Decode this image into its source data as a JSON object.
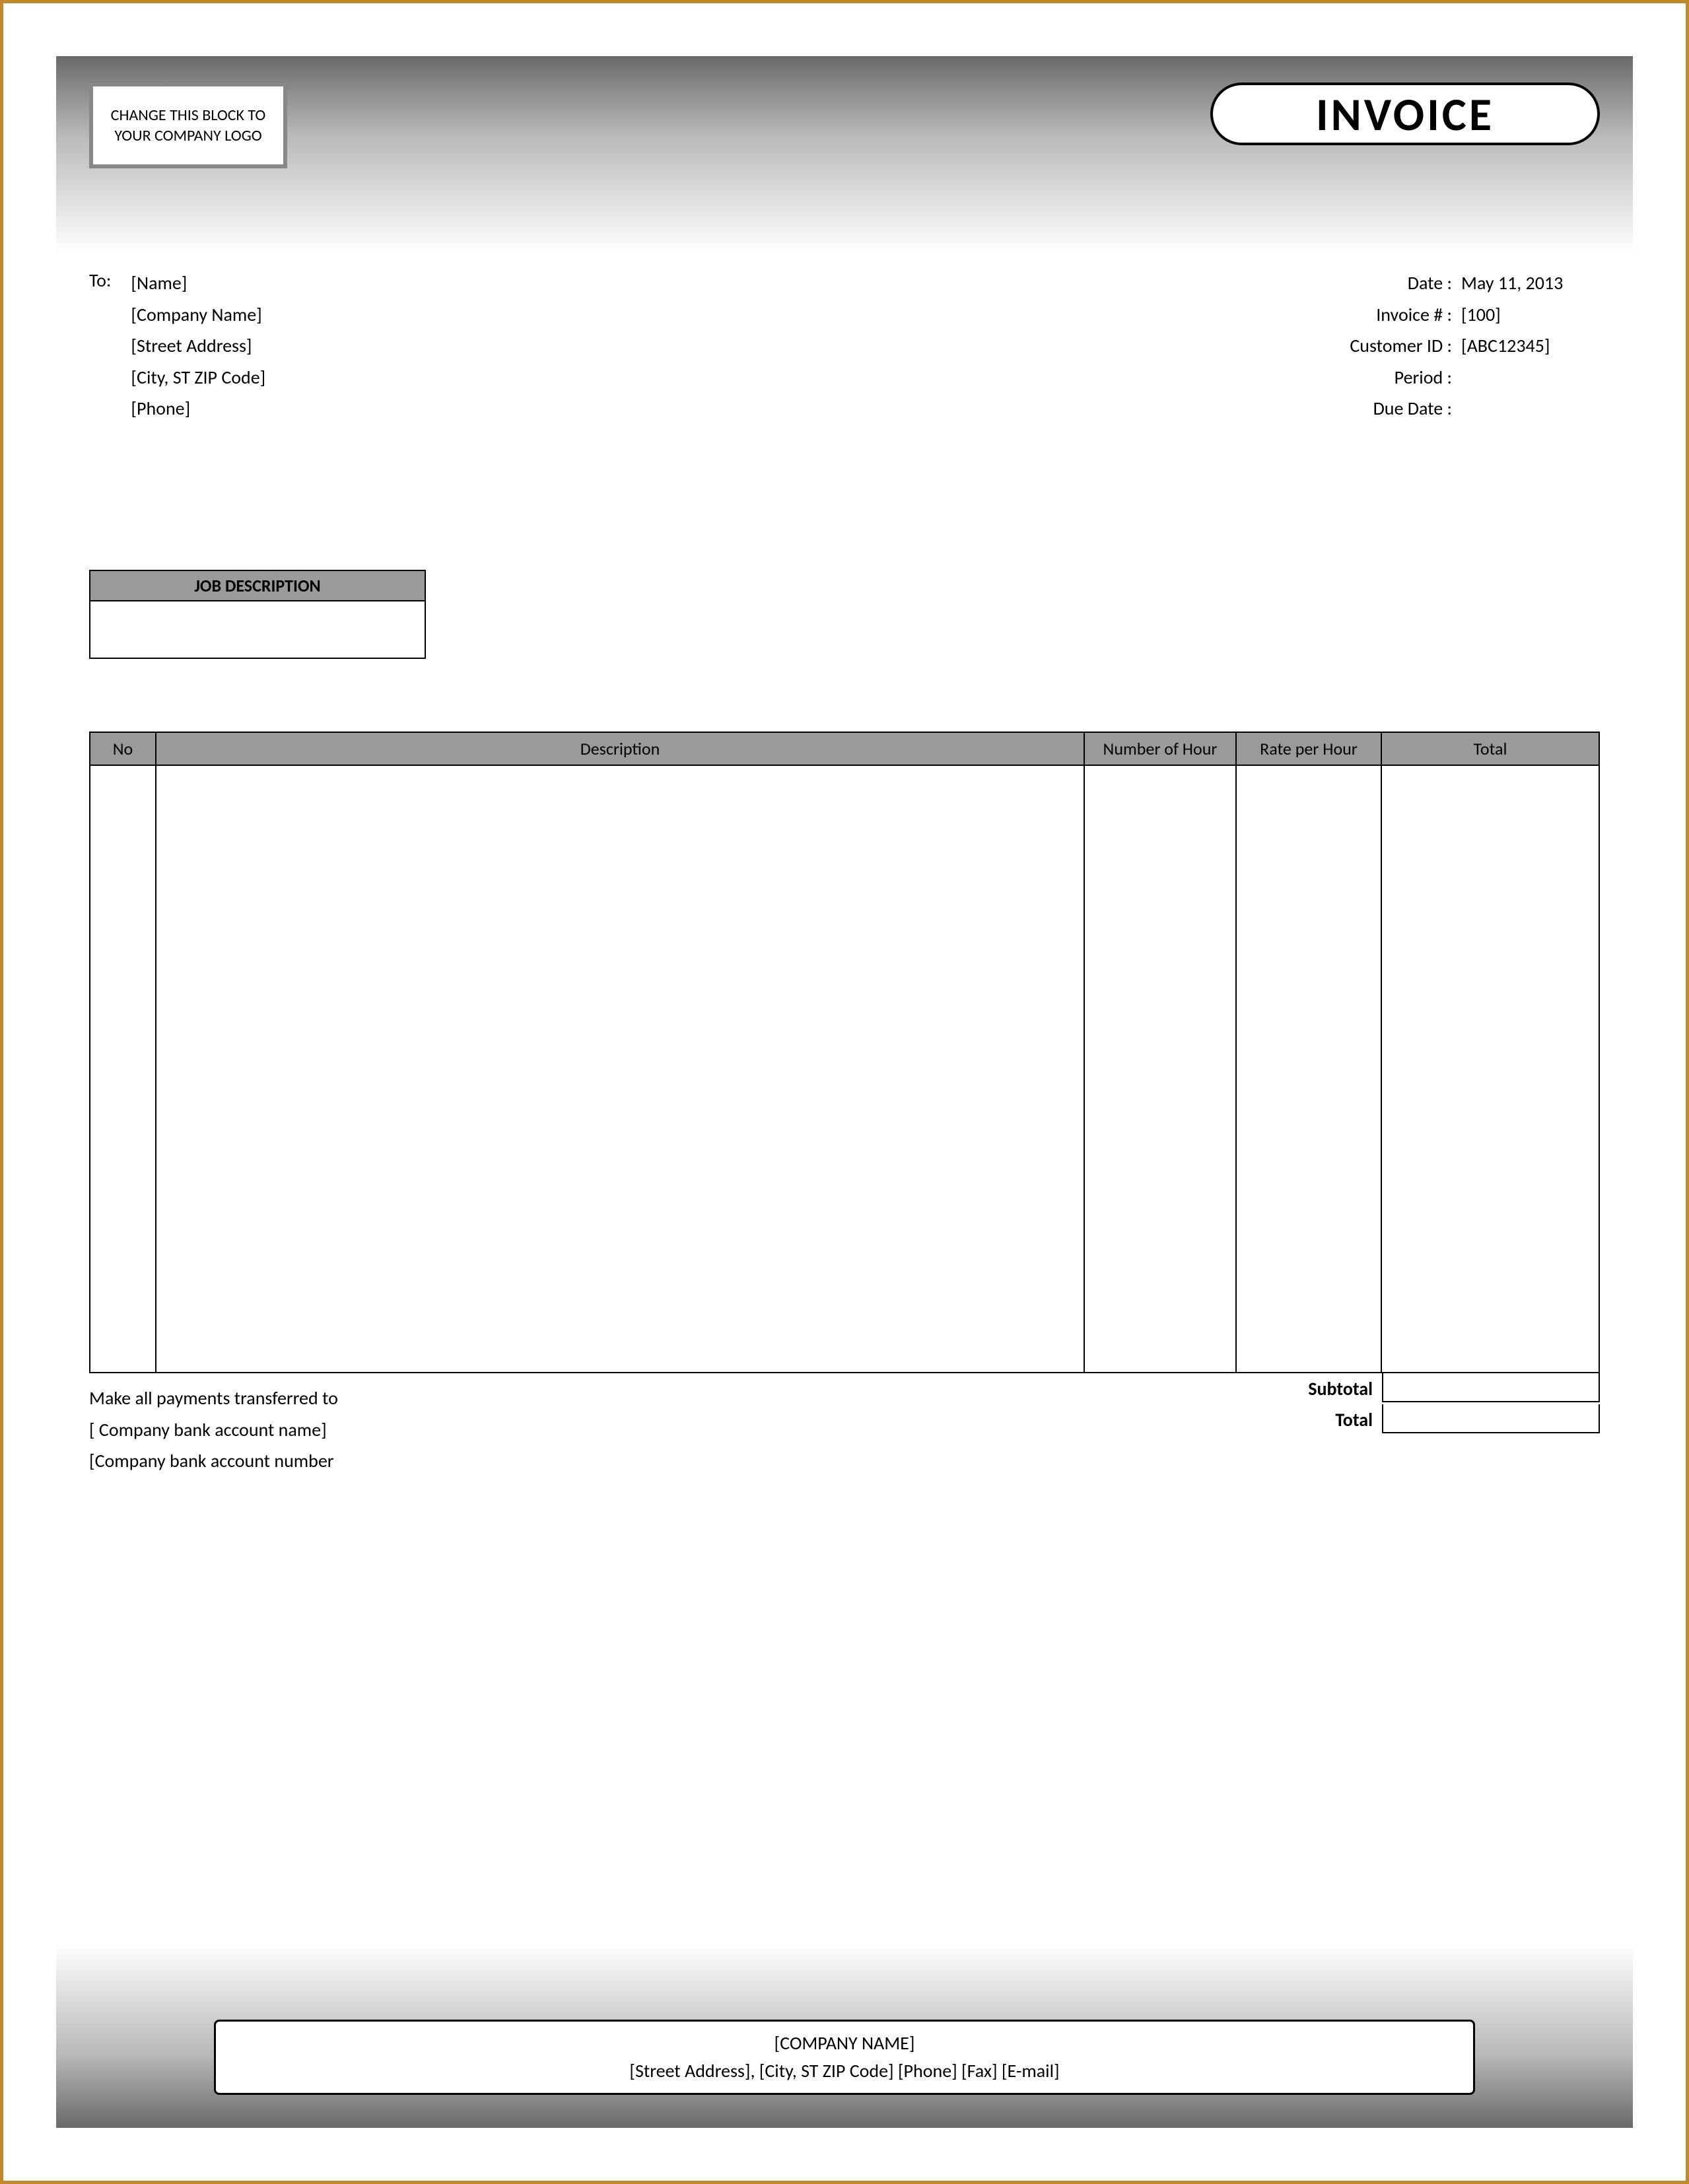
{
  "header": {
    "logo_placeholder": "CHANGE THIS BLOCK TO YOUR COMPANY LOGO",
    "title": "INVOICE"
  },
  "to": {
    "label": "To:",
    "name": "[Name]",
    "company": "[Company Name]",
    "street": "[Street Address]",
    "city": "[City, ST  ZIP Code]",
    "phone": "[Phone]"
  },
  "meta": {
    "date_label": "Date :",
    "date_value": "May 11, 2013",
    "invoice_no_label": "Invoice # :",
    "invoice_no_value": "[100]",
    "customer_id_label": "Customer ID :",
    "customer_id_value": "[ABC12345]",
    "period_label": "Period :",
    "period_value": "",
    "due_date_label": "Due Date :",
    "due_date_value": ""
  },
  "job": {
    "heading": "JOB DESCRIPTION"
  },
  "table": {
    "col_no": "No",
    "col_desc": "Description",
    "col_num_hour": "Number of Hour",
    "col_rate": "Rate per Hour",
    "col_total": "Total"
  },
  "summary": {
    "subtotal_label": "Subtotal",
    "subtotal_value": "",
    "total_label": "Total",
    "total_value": ""
  },
  "payment": {
    "line1": "Make all payments transferred to",
    "line2": "[ Company bank account name]",
    "line3": "[Company bank account number"
  },
  "footer": {
    "company": "[COMPANY NAME]",
    "details": "[Street Address], [City, ST  ZIP Code]  [Phone]  [Fax]  [E-mail]"
  }
}
